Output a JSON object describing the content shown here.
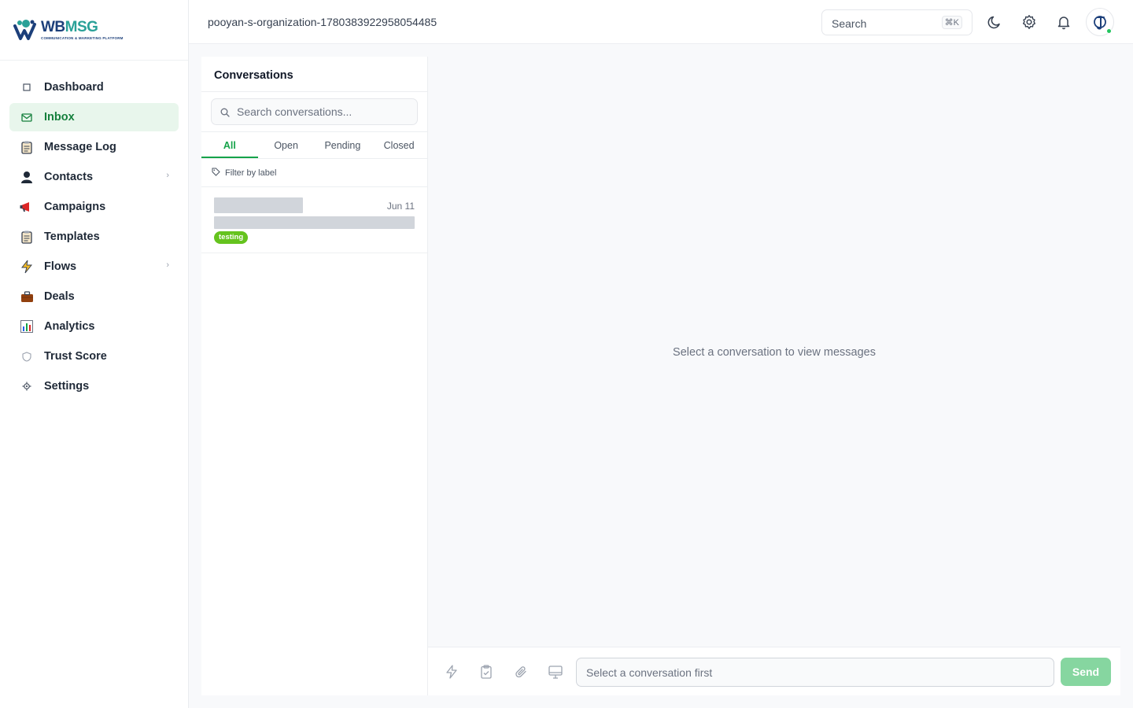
{
  "brand": {
    "name_part1": "WB",
    "name_part2": "MSG",
    "tagline": "COMMUNICATION & MARKETING PLATFORM"
  },
  "sidebar": {
    "items": [
      {
        "label": "Dashboard",
        "icon": "square-icon",
        "active": false
      },
      {
        "label": "Inbox",
        "icon": "envelope-icon",
        "active": true
      },
      {
        "label": "Message Log",
        "icon": "clipboard-icon",
        "active": false
      },
      {
        "label": "Contacts",
        "icon": "person-icon",
        "active": false,
        "expandable": true
      },
      {
        "label": "Campaigns",
        "icon": "megaphone-icon",
        "active": false
      },
      {
        "label": "Templates",
        "icon": "clipboard-icon",
        "active": false
      },
      {
        "label": "Flows",
        "icon": "lightning-icon",
        "active": false,
        "expandable": true
      },
      {
        "label": "Deals",
        "icon": "briefcase-icon",
        "active": false
      },
      {
        "label": "Analytics",
        "icon": "bar-chart-icon",
        "active": false
      },
      {
        "label": "Trust Score",
        "icon": "shield-icon",
        "active": false
      },
      {
        "label": "Settings",
        "icon": "gear-icon",
        "active": false
      }
    ]
  },
  "header": {
    "org_name": "pooyan-s-organization-1780383922958054485",
    "search_label": "Search",
    "search_shortcut": "⌘K"
  },
  "conversations": {
    "title": "Conversations",
    "search_placeholder": "Search conversations...",
    "tabs": [
      {
        "label": "All",
        "active": true
      },
      {
        "label": "Open",
        "active": false
      },
      {
        "label": "Pending",
        "active": false
      },
      {
        "label": "Closed",
        "active": false
      }
    ],
    "filter_label": "Filter by label",
    "items": [
      {
        "date": "Jun 11",
        "label": "testing"
      }
    ]
  },
  "chat": {
    "empty_message": "Select a conversation to view messages",
    "input_placeholder": "Select a conversation first",
    "send_label": "Send"
  },
  "colors": {
    "accent": "#16a34a",
    "active_bg": "#e8f6ec",
    "label_green": "#65c31e",
    "send_disabled": "#86d6a0"
  }
}
